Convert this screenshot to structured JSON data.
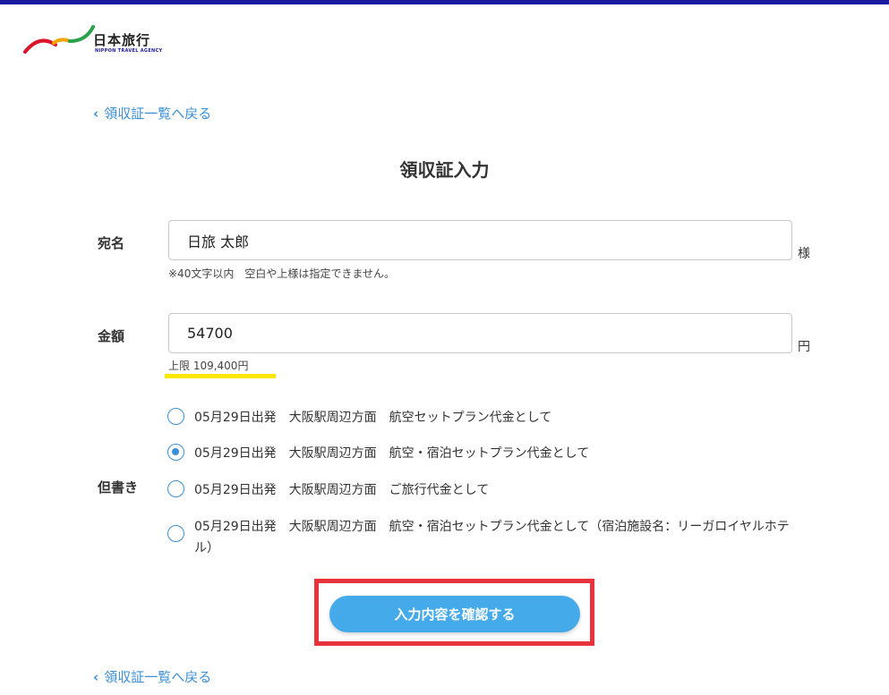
{
  "header": {
    "logo_text": "日本旅行",
    "logo_sub": "NIPPON TRAVEL AGENCY",
    "accent_color": "#1a1aa0"
  },
  "nav": {
    "back_label": "領収証一覧へ戻る"
  },
  "page": {
    "title": "領収証入力"
  },
  "form": {
    "addressee": {
      "label": "宛名",
      "value": "日旅 太郎",
      "suffix": "様",
      "note": "※40文字以内　空白や上様は指定できません。"
    },
    "amount": {
      "label": "金額",
      "value": "54700",
      "suffix": "円",
      "limit_note": "上限 109,400円"
    },
    "proviso": {
      "label": "但書き",
      "selected_index": 1,
      "options": [
        "05月29日出発　大阪駅周辺方面　航空セットプラン代金として",
        "05月29日出発　大阪駅周辺方面　航空・宿泊セットプラン代金として",
        "05月29日出発　大阪駅周辺方面　ご旅行代金として",
        "05月29日出発　大阪駅周辺方面　航空・宿泊セットプラン代金として（宿泊施設名：リーガロイヤルホテル）"
      ]
    },
    "submit_label": "入力内容を確認する"
  },
  "colors": {
    "link": "#3c8fd6",
    "button": "#45aaea",
    "highlight": "#ffe800",
    "annotation_box": "#e8323c"
  }
}
